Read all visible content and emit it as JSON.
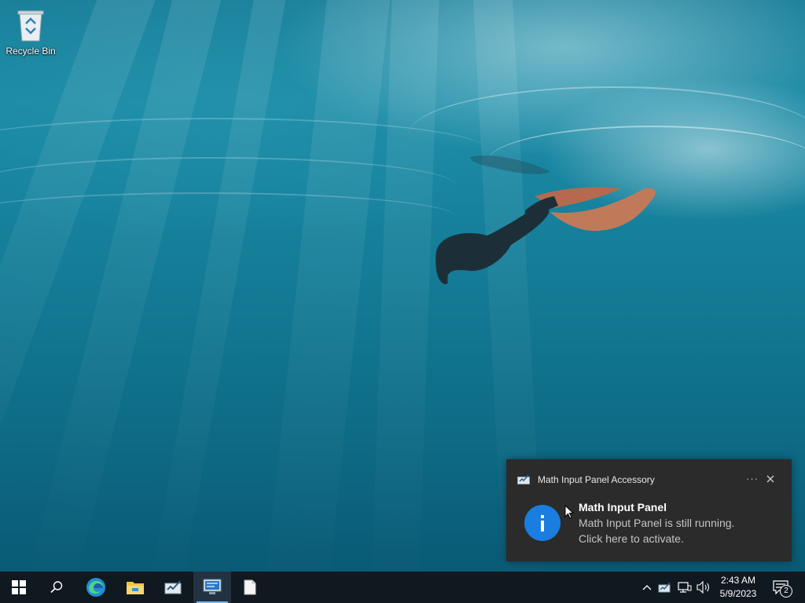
{
  "desktop": {
    "icons": [
      {
        "label": "Recycle Bin",
        "icon": "recycle-bin-icon"
      }
    ]
  },
  "toast": {
    "app_name": "Math Input Panel Accessory",
    "app_icon": "math-input-panel-icon",
    "more_label": "···",
    "title": "Math Input Panel",
    "line1": "Math Input Panel is still running.",
    "line2": "Click here to activate.",
    "info_glyph": "i",
    "info_color": "#1a7de0"
  },
  "taskbar": {
    "buttons": [
      {
        "name": "start",
        "icon": "windows-logo-icon"
      },
      {
        "name": "search",
        "icon": "search-icon"
      },
      {
        "name": "edge",
        "icon": "edge-icon"
      },
      {
        "name": "file-explorer",
        "icon": "folder-icon"
      },
      {
        "name": "math-input-panel",
        "icon": "math-input-panel-icon"
      },
      {
        "name": "remote-desktop",
        "icon": "remote-desktop-icon",
        "active": true
      },
      {
        "name": "document",
        "icon": "document-icon"
      }
    ],
    "tray": [
      "chevron-up-icon",
      "math-input-panel-icon",
      "network-icon",
      "volume-icon"
    ],
    "clock": {
      "time": "2:43 AM",
      "date": "5/9/2023"
    },
    "notifications": {
      "count": "2"
    }
  },
  "colors": {
    "taskbar": "#101820",
    "toast_bg": "#2b2b2b",
    "accent": "#76b9ed"
  }
}
